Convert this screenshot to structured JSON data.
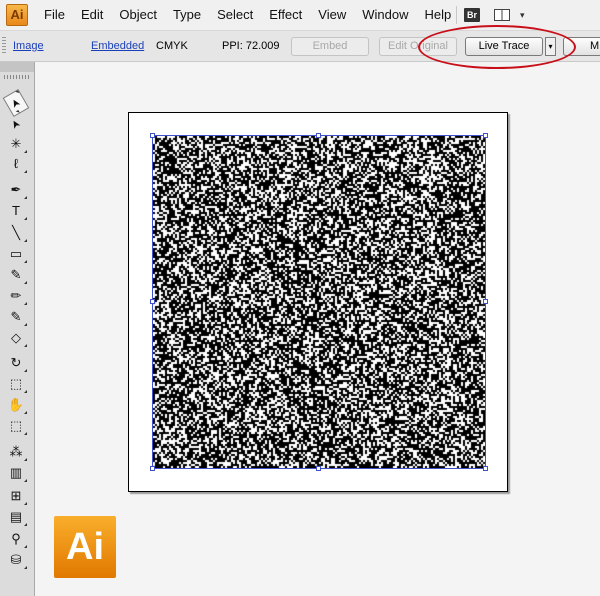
{
  "app": {
    "logo": "Ai"
  },
  "menu": [
    "File",
    "Edit",
    "Object",
    "Type",
    "Select",
    "Effect",
    "View",
    "Window",
    "Help"
  ],
  "menubar_right": {
    "bridge_label": "Br",
    "arrange_icon": "arrange-documents-icon",
    "dropdown_arrow": "▾"
  },
  "control_bar": {
    "object_type": "Image",
    "link_status": "Embedded",
    "color_mode": "CMYK",
    "ppi": "PPI: 72.009",
    "embed_button": "Embed",
    "edit_original_button": "Edit Original",
    "live_trace_button": "Live Trace",
    "live_trace_dropdown": "▾",
    "mask_button": "M",
    "annotation_color": "#c8101a"
  },
  "tools": [
    {
      "name": "selection-tool-icon",
      "glyph": "➤"
    },
    {
      "name": "direct-selection-tool-icon",
      "glyph": "➤"
    },
    {
      "name": "magic-wand-tool-icon",
      "glyph": "✳"
    },
    {
      "name": "lasso-tool-icon",
      "glyph": "ℓ"
    },
    {
      "name": "pen-tool-icon",
      "glyph": "✒"
    },
    {
      "name": "type-tool-icon",
      "glyph": "T"
    },
    {
      "name": "line-segment-tool-icon",
      "glyph": "╲"
    },
    {
      "name": "rectangle-tool-icon",
      "glyph": "▭"
    },
    {
      "name": "paintbrush-tool-icon",
      "glyph": "✎"
    },
    {
      "name": "pencil-tool-icon",
      "glyph": "✏"
    },
    {
      "name": "blob-brush-tool-icon",
      "glyph": "✎"
    },
    {
      "name": "eraser-tool-icon",
      "glyph": "◇"
    },
    {
      "name": "rotate-tool-icon",
      "glyph": "↻"
    },
    {
      "name": "scale-tool-icon",
      "glyph": "⬚"
    },
    {
      "name": "warp-tool-icon",
      "glyph": "✋"
    },
    {
      "name": "free-transform-tool-icon",
      "glyph": "⬚"
    },
    {
      "name": "symbol-sprayer-tool-icon",
      "glyph": "⁂"
    },
    {
      "name": "column-graph-tool-icon",
      "glyph": "▥"
    },
    {
      "name": "mesh-tool-icon",
      "glyph": "⊞"
    },
    {
      "name": "gradient-tool-icon",
      "glyph": "▤"
    },
    {
      "name": "eyedropper-tool-icon",
      "glyph": "⚲"
    },
    {
      "name": "live-paint-bucket-tool-icon",
      "glyph": "⛁"
    }
  ],
  "big_logo": "Ai"
}
